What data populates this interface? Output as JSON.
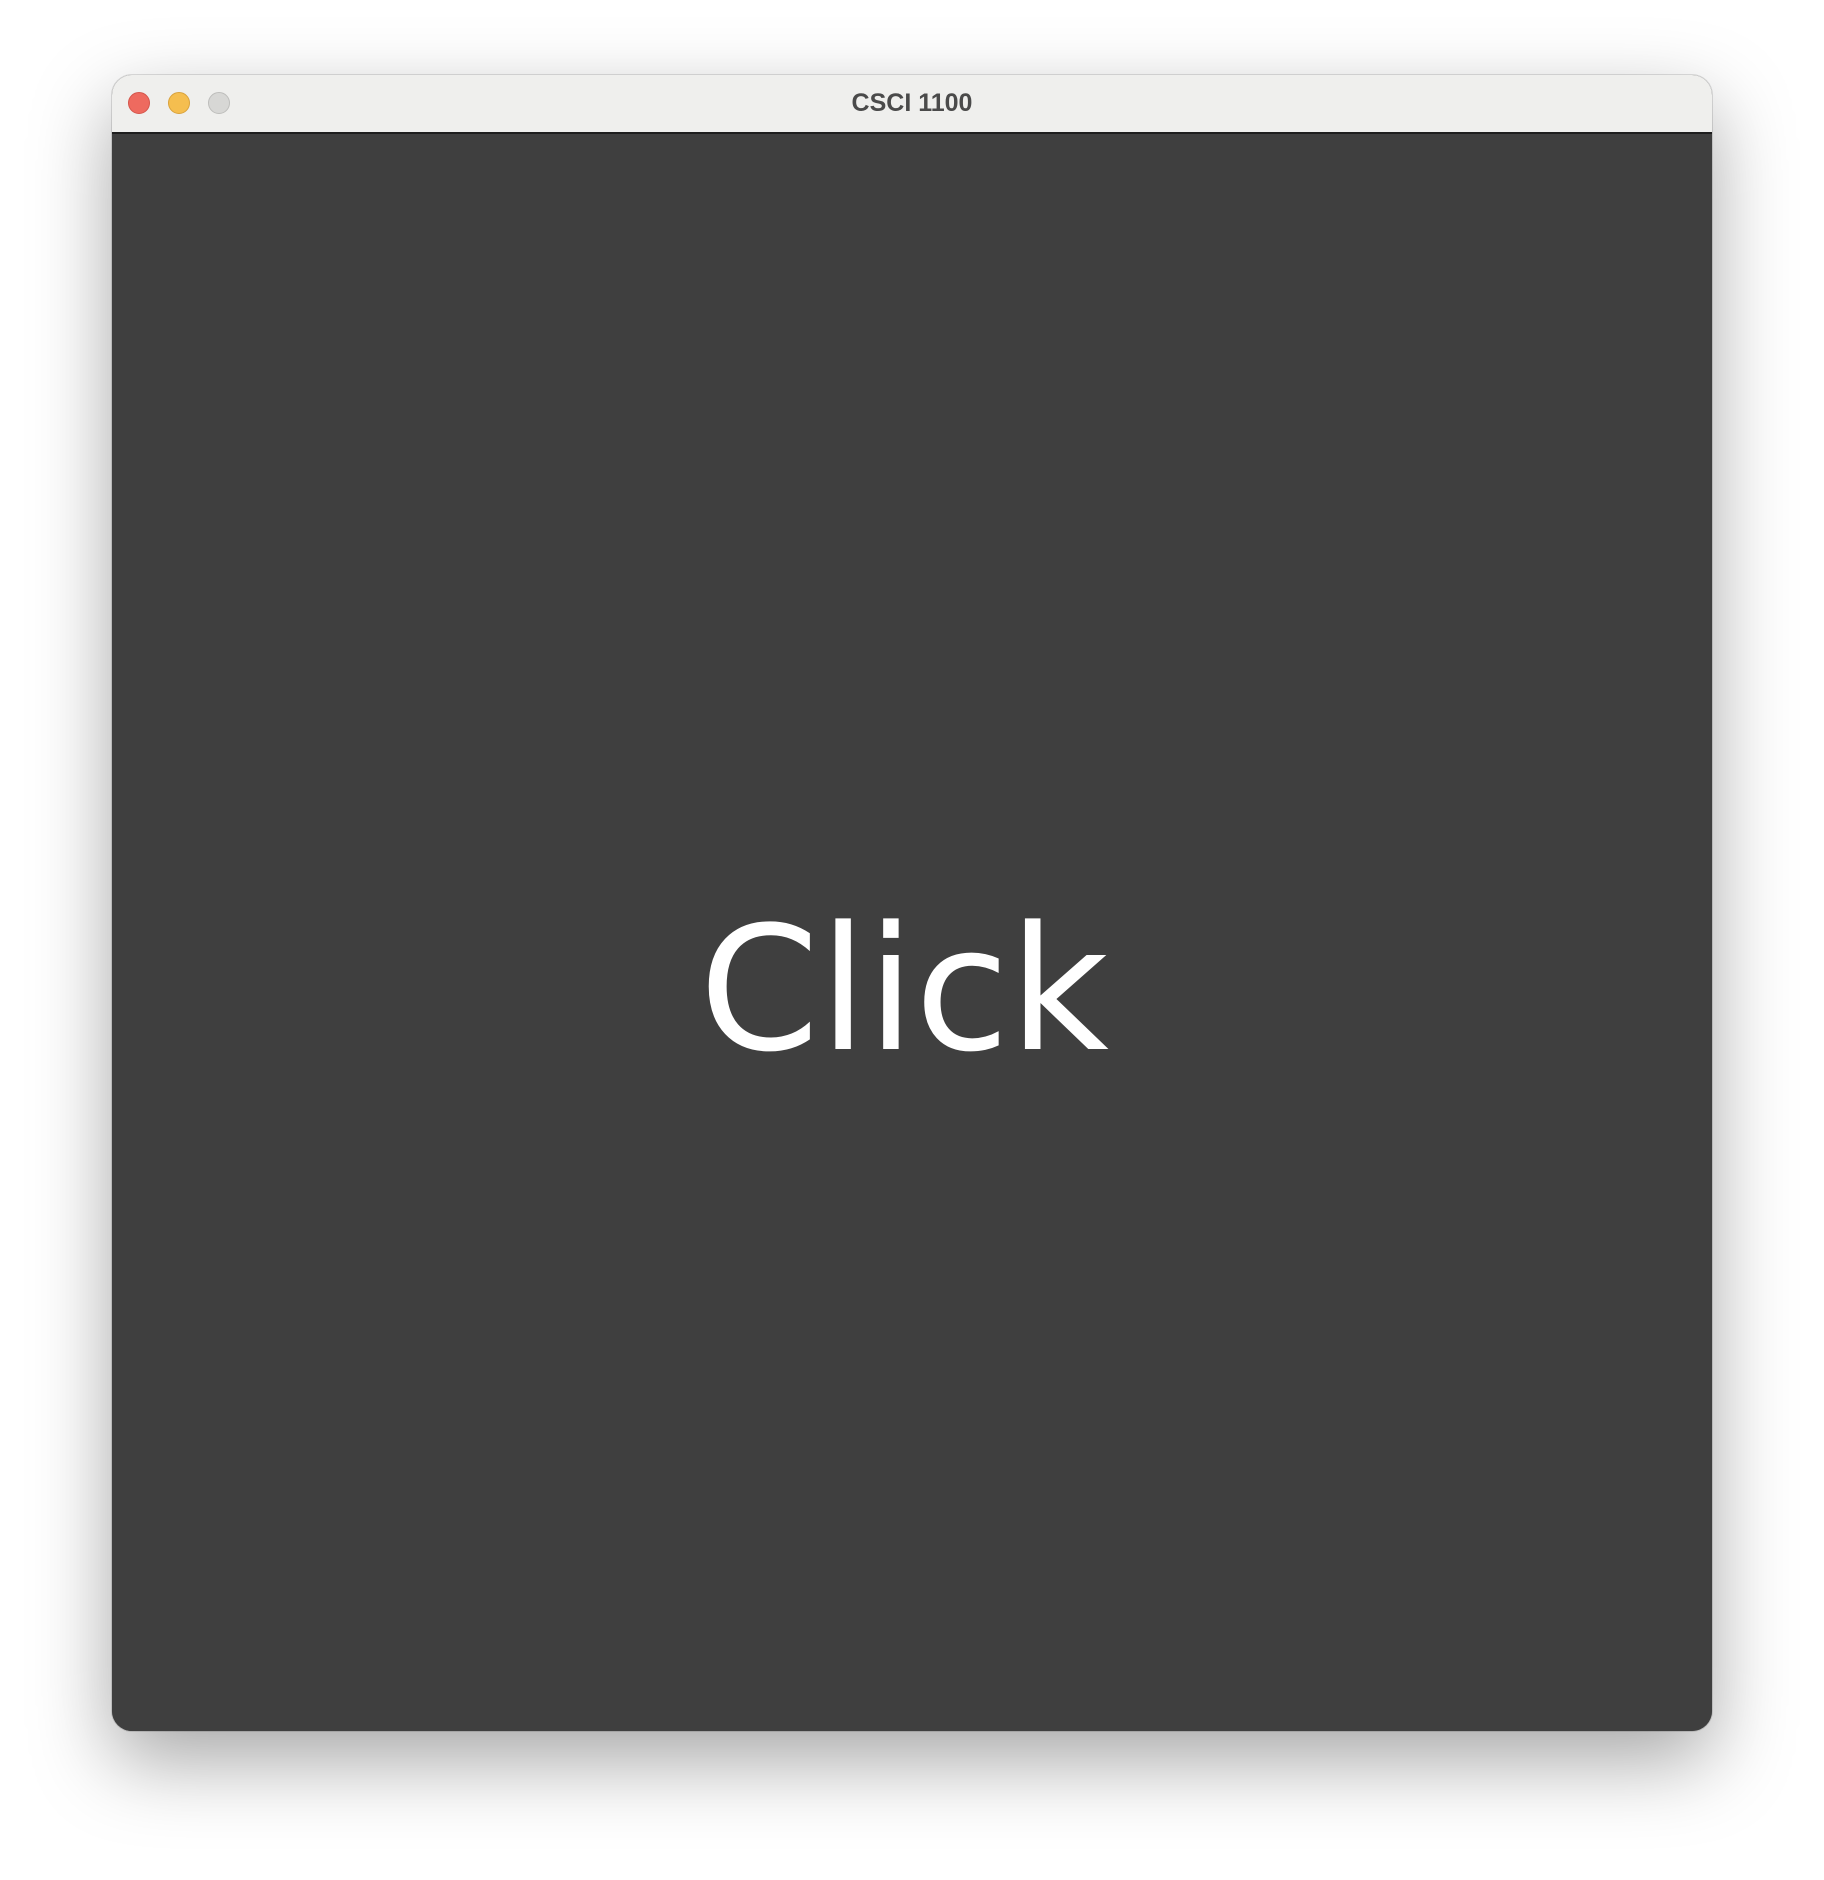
{
  "window": {
    "title": "CSCI 1100",
    "buttons": {
      "close": "close-button",
      "minimize": "minimize-button",
      "maximize": "maximize-button"
    }
  },
  "canvas": {
    "label": "Click",
    "background_color": "#3f3f3f",
    "text_color": "#ffffff"
  }
}
